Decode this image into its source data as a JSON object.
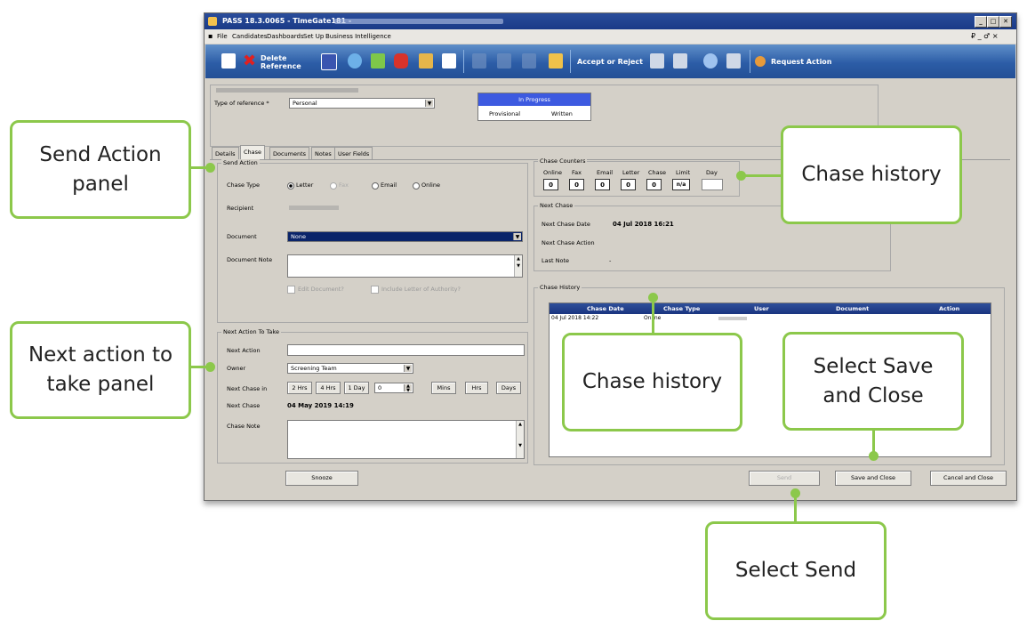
{
  "window": {
    "title": "PASS 18.3.0065 - TimeGate181 -",
    "buttons": [
      "_",
      "□",
      "✕"
    ],
    "menu": [
      "File",
      "Candidates",
      "Dashboards",
      "Set Up",
      "Business Intelligence"
    ],
    "menu_right": "₽ _ ♂ ×"
  },
  "toolbar": {
    "delete_label": "Delete Reference",
    "accept_label": "Accept or Reject",
    "request_label": "Request Action"
  },
  "header": {
    "type_label": "Type of reference *",
    "type_value": "Personal",
    "status_in_progress": "In Progress",
    "status_provisional": "Provisional",
    "status_written": "Written"
  },
  "tabs": [
    "Details",
    "Chase",
    "Documents",
    "Notes",
    "User Fields"
  ],
  "send_action": {
    "title": "Send Action",
    "chase_type_label": "Chase Type",
    "options": [
      "Letter",
      "Fax",
      "Email",
      "Online"
    ],
    "recipient_label": "Recipient",
    "document_label": "Document",
    "document_value": "None",
    "document_note_label": "Document Note",
    "edit_document": "Edit Document?",
    "include_letter": "Include Letter of Authority?"
  },
  "next_action": {
    "title": "Next Action To Take",
    "next_action_label": "Next Action",
    "owner_label": "Owner",
    "owner_value": "Screening Team",
    "next_chase_in_label": "Next Chase in",
    "quick": [
      "2 Hrs",
      "4 Hrs",
      "1 Day"
    ],
    "spin_value": "0",
    "units": [
      "Mins",
      "Hrs",
      "Days"
    ],
    "next_chase_label": "Next Chase",
    "next_chase_value": "04 May 2019 14:19",
    "chase_note_label": "Chase Note"
  },
  "chase_counters": {
    "title": "Chase Counters",
    "headers": [
      "Online",
      "Fax",
      "Email",
      "Letter",
      "Chase",
      "Limit",
      "Day"
    ],
    "values": [
      "0",
      "0",
      "0",
      "0",
      "0",
      "n/a",
      ""
    ]
  },
  "next_chase": {
    "title": "Next Chase",
    "date_label": "Next Chase Date",
    "date_value": "04 Jul 2018 16:21",
    "action_label": "Next Chase Action",
    "note_label": "Last Note",
    "note_value": "-"
  },
  "chase_history": {
    "title": "Chase History",
    "columns": [
      "Chase Date",
      "Chase Type",
      "User",
      "Document",
      "Action"
    ],
    "rows": [
      {
        "date": "04 Jul 2018 14:22",
        "type": "Online"
      }
    ]
  },
  "bottom": {
    "snooze": "Snooze",
    "send": "Send",
    "save_close": "Save and Close",
    "cancel_close": "Cancel and Close"
  },
  "callouts": {
    "send_action_panel": "Send Action panel",
    "next_action_panel": "Next action to take panel",
    "chase_history_top": "Chase history",
    "chase_history_mid": "Chase history",
    "select_save": "Select Save and Close",
    "select_send": "Select Send"
  },
  "colors": {
    "callout_border": "#8cc84b",
    "toolbar": "#2c5da7",
    "selection": "#0a246a"
  }
}
